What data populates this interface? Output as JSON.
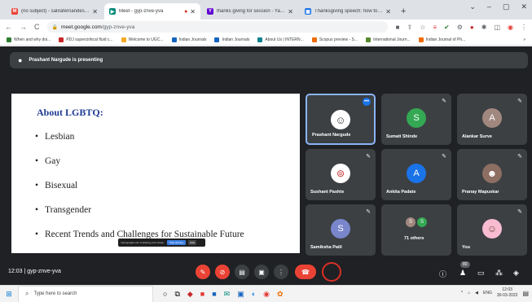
{
  "tabs": [
    {
      "title": "(no subject) - salirafernandes21",
      "favicon": "gmail-icon",
      "color": "#ea4335",
      "glyph": "M",
      "active": false
    },
    {
      "title": "Meet - gyp-znve-yva",
      "favicon": "meet-icon",
      "color": "#00897b",
      "glyph": "▶",
      "active": true
    },
    {
      "title": "thanks giving for session - Yahoo",
      "favicon": "yahoo-icon",
      "color": "#6001d2",
      "glyph": "Y",
      "active": false
    },
    {
      "title": "Thanksgiving speech: how to pr",
      "favicon": "page-icon",
      "color": "#1a73e8",
      "glyph": "▣",
      "active": false
    }
  ],
  "new_tab": "+",
  "window_controls": [
    "⌄",
    "–",
    "▢",
    "✕"
  ],
  "url": {
    "domain": "meet.google.com",
    "path": "/gyp-znve-yva"
  },
  "bookmarks": [
    {
      "label": "When and why doi...",
      "color": "#2e7d32"
    },
    {
      "label": "PDJ superciritical fluid c...",
      "color": "#c62828"
    },
    {
      "label": "Welcome to UGC...",
      "color": "#f9a825"
    },
    {
      "label": "Indian Journals",
      "color": "#1565c0"
    },
    {
      "label": "Indian Journals",
      "color": "#1565c0"
    },
    {
      "label": "About Us | INTERN...",
      "color": "#00838f"
    },
    {
      "label": "Scopus preview - S...",
      "color": "#ef6c00"
    },
    {
      "label": "International Journ...",
      "color": "#558b2f"
    },
    {
      "label": "Indian Journal of Ph...",
      "color": "#ef6c00"
    }
  ],
  "presenting": "Prashant Nargude is presenting",
  "slide": {
    "title": "About LGBTQ:",
    "bullets": [
      "Lesbian",
      "Gay",
      "Bisexual",
      "Transgender",
      "Recent Trends and Challenges for Sustainable Future"
    ],
    "notice": "meet.google.com is sharing your screen.",
    "notice_stop": "Stop sharing",
    "notice_hide": "Hide"
  },
  "participants": [
    {
      "name": "Prashant Nargude",
      "initial": "",
      "avatar_color": "#ffffff",
      "photo": true,
      "selected": true
    },
    {
      "name": "Sumati Shinde",
      "initial": "S",
      "avatar_color": "#34a853",
      "photo": false,
      "selected": false
    },
    {
      "name": "Alankar Surve",
      "initial": "A",
      "avatar_color": "#a1887f",
      "photo": false,
      "selected": false
    },
    {
      "name": "Sushant Pashte",
      "initial": "",
      "avatar_color": "#ffffff",
      "photo": true,
      "selected": false
    },
    {
      "name": "Ankita Padate",
      "initial": "A",
      "avatar_color": "#1a73e8",
      "photo": false,
      "selected": false
    },
    {
      "name": "Pranay Mapuskar",
      "initial": "",
      "avatar_color": "#8d6e63",
      "photo": true,
      "selected": false
    },
    {
      "name": "Samiksha Patil",
      "initial": "S",
      "avatar_color": "#7986cb",
      "photo": false,
      "selected": false
    },
    {
      "name": "71 others",
      "initial": "",
      "avatar_color": "#5f6368",
      "photo": false,
      "selected": false
    },
    {
      "name": "You",
      "initial": "",
      "avatar_color": "#f8bbd0",
      "photo": true,
      "selected": false
    }
  ],
  "others_minis": [
    "S",
    "S"
  ],
  "bottom": {
    "time": "12:03",
    "meeting": "gyp-znve-yva",
    "people_count": "80"
  },
  "taskbar": {
    "search_placeholder": "Type here to search",
    "lang": "ENG",
    "time": "12:03",
    "date": "30-03-2022"
  }
}
